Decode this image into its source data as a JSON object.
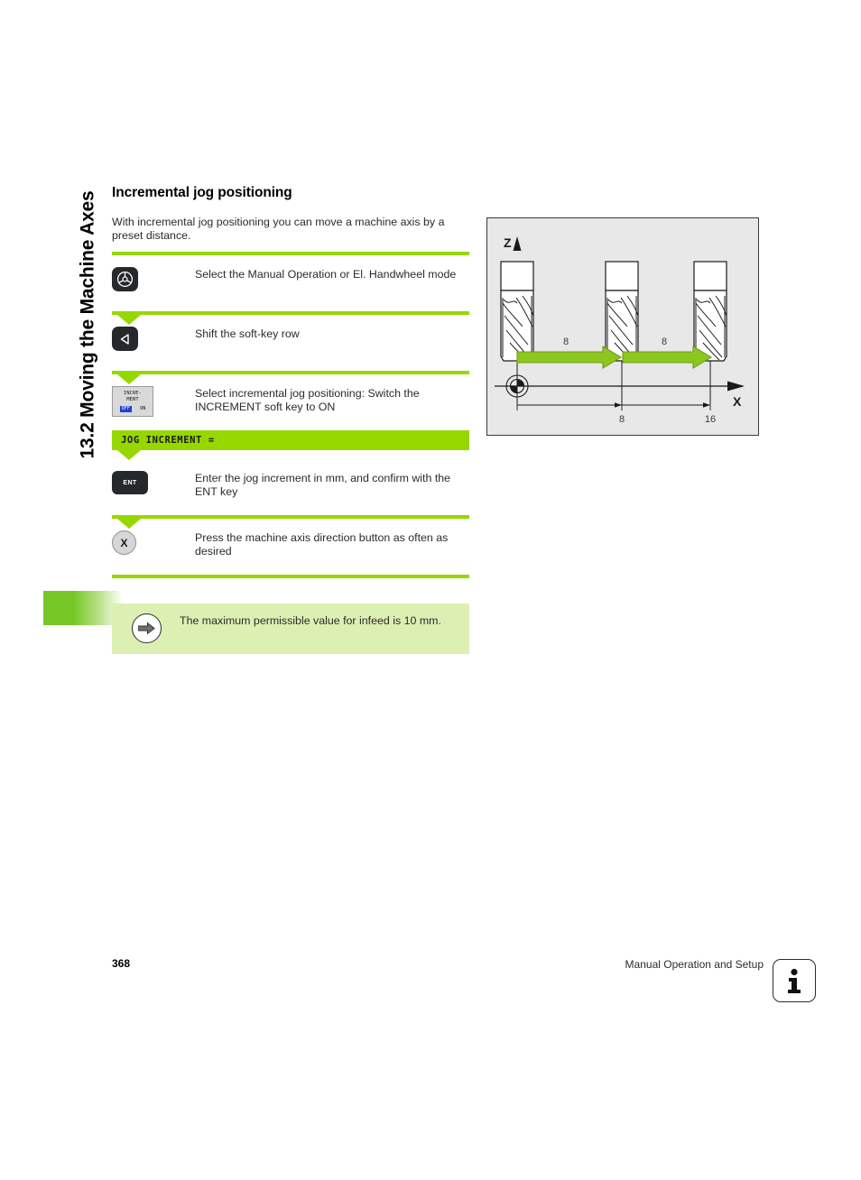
{
  "chapter": {
    "sidebar_title": "13.2 Moving the Machine Axes"
  },
  "heading": "Incremental jog positioning",
  "intro": "With incremental jog positioning you can move a machine axis by a preset distance.",
  "steps": [
    {
      "key_icon": "handwheel-icon",
      "key_label": "",
      "text": "Select the Manual Operation or El. Handwheel mode"
    },
    {
      "key_icon": "left-triangle-icon",
      "key_label": "",
      "text": "Shift the soft-key row"
    },
    {
      "key_icon": "increment-softkey",
      "key_label": "",
      "softkey": {
        "line1": "INCRE-",
        "line2": "MENT",
        "off": "OFF",
        "on": "ON"
      },
      "text": "Select incremental jog positioning: Switch the INCREMENT soft key to ON"
    },
    {
      "key_icon": "ent-key",
      "key_label": "ENT",
      "text": "Enter the jog increment in mm, and confirm with the ENT key"
    },
    {
      "key_icon": "axis-direction-button",
      "key_label": "X",
      "text": "Press the machine axis direction button as often as desired"
    }
  ],
  "dialog_bar": {
    "text": "JOG INCREMENT ="
  },
  "note": {
    "icon": "arrow-right-icon",
    "text": "The maximum permissible value for infeed is 10 mm."
  },
  "figure": {
    "axis_z_label": "Z",
    "axis_x_label": "X",
    "move_labels": [
      "8",
      "8"
    ],
    "position_labels": [
      "8",
      "16"
    ],
    "tool_count": 3
  },
  "footer": {
    "page_number": "368",
    "section": "Manual Operation and Setup",
    "info_icon": "info-icon"
  },
  "colors": {
    "accent_green": "#96d700",
    "note_green": "#ddf0b4",
    "tab_green": "#76c726",
    "figure_bg": "#e8e8e8",
    "key_dark": "#26292b",
    "softkey_blue": "#1f3fd0"
  }
}
